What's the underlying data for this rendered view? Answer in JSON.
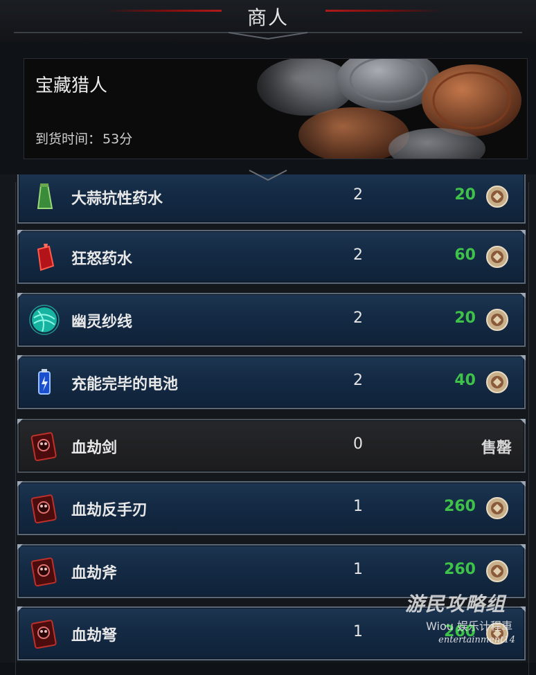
{
  "header": {
    "title": "商人"
  },
  "vendor": {
    "name": "宝藏猎人",
    "restock_label": "到货时间：",
    "restock_value": "53分"
  },
  "items": [
    {
      "name": "大蒜抗性药水",
      "quantity": "2",
      "price": "20",
      "icon": "garlic-potion-icon",
      "status": ""
    },
    {
      "name": "狂怒药水",
      "quantity": "2",
      "price": "60",
      "icon": "rage-potion-icon",
      "status": ""
    },
    {
      "name": "幽灵纱线",
      "quantity": "2",
      "price": "20",
      "icon": "ghost-yarn-icon",
      "status": ""
    },
    {
      "name": "充能完毕的电池",
      "quantity": "2",
      "price": "40",
      "icon": "battery-icon",
      "status": ""
    },
    {
      "name": "血劫剑",
      "quantity": "0",
      "price": "",
      "icon": "blood-book-icon",
      "status": "售罄"
    },
    {
      "name": "血劫反手刃",
      "quantity": "1",
      "price": "260",
      "icon": "blood-book-icon",
      "status": ""
    },
    {
      "name": "血劫斧",
      "quantity": "1",
      "price": "260",
      "icon": "blood-book-icon",
      "status": ""
    },
    {
      "name": "血劫弩",
      "quantity": "1",
      "price": "260",
      "icon": "blood-book-icon",
      "status": ""
    }
  ],
  "watermark": {
    "main": "游民攻略组",
    "sub": "Wiou 娱乐计程車",
    "en": "entertainment14"
  },
  "colors": {
    "price_green": "#3fc24a",
    "row_blue": "#142a44",
    "soldout_gray": "#1c1c1e",
    "accent_red": "#b01a1a"
  }
}
